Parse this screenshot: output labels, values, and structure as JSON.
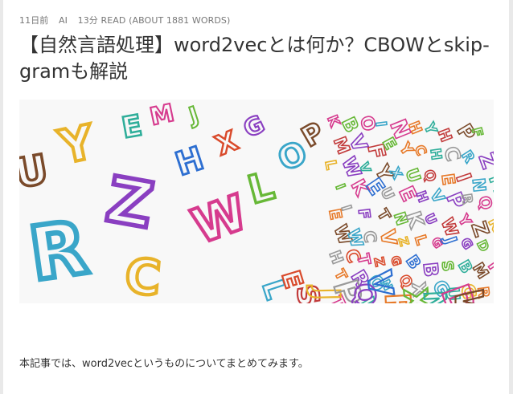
{
  "meta": {
    "date": "11日前",
    "author": "AI",
    "reading": "13分 READ (ABOUT 1881 WORDS)"
  },
  "article": {
    "title": "【自然言語処理】word2vecとは何か？CBOWとskip-gramも解説",
    "intro": "本記事では、word2vecというものについてまとめてみます。"
  },
  "hero": {
    "image_name": "colorful-alphabet-letters-image",
    "letters": [
      "R",
      "Z",
      "W",
      "L",
      "O",
      "P",
      "H",
      "X",
      "G",
      "Y",
      "E",
      "M",
      "Q",
      "K",
      "N",
      "A",
      "F",
      "S",
      "T",
      "V",
      "B",
      "D",
      "C",
      "U",
      "J",
      "I"
    ],
    "colors": [
      "#3aa6c9",
      "#8a3fc1",
      "#d63b8e",
      "#e8b32a",
      "#67b837",
      "#d94a2b",
      "#2e6fd1",
      "#7a4a2a",
      "#9a9a9a",
      "#2fae9a",
      "#c23b3b",
      "#e77a2a"
    ]
  }
}
